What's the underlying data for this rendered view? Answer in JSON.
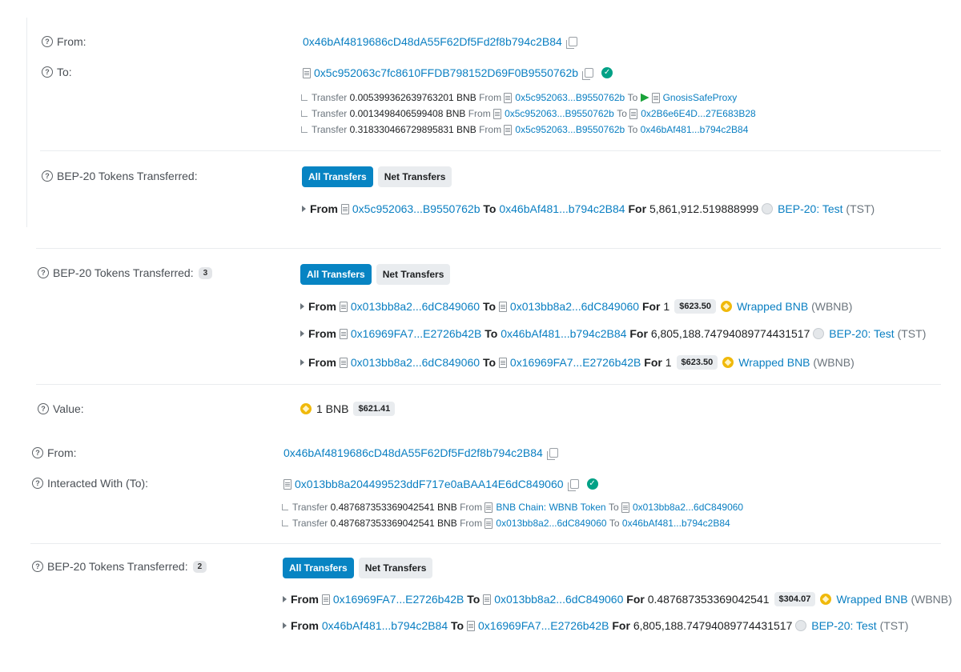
{
  "sec1": {
    "from_label": "From:",
    "from_addr": "0x46bAf4819686cD48dA55F62Df5Fd2f8b794c2B84",
    "to_label": "To:",
    "to_addr": "0x5c952063c7fc8610FFDB798152D69F0B9550762b",
    "internal": [
      {
        "kw": "Transfer",
        "amount": "0.005399362639763201 BNB",
        "from_kw": "From",
        "from": "0x5c952063...B9550762b",
        "to_kw": "To",
        "to": "GnosisSafeProxy"
      },
      {
        "kw": "Transfer",
        "amount": "0.0013498406599408 BNB",
        "from_kw": "From",
        "from": "0x5c952063...B9550762b",
        "to_kw": "To",
        "to": "0x2B6e6E4D...27E683B28"
      },
      {
        "kw": "Transfer",
        "amount": "0.318330466729895831 BNB",
        "from_kw": "From",
        "from": "0x5c952063...B9550762b",
        "to_kw": "To",
        "to": "0x46bAf481...b794c2B84"
      }
    ],
    "tokens_label": "BEP-20 Tokens Transferred:",
    "btn_all": "All Transfers",
    "btn_net": "Net Transfers",
    "transfers": [
      {
        "from_kw": "From",
        "from": "0x5c952063...B9550762b",
        "to_kw": "To",
        "to": "0x46bAf481...b794c2B84",
        "for_kw": "For",
        "amount": "5,861,912.519888999",
        "token": "BEP-20: Test",
        "symbol": "(TST)"
      }
    ]
  },
  "sec2": {
    "tokens_label": "BEP-20 Tokens Transferred:",
    "count": "3",
    "btn_all": "All Transfers",
    "btn_net": "Net Transfers",
    "transfers": [
      {
        "from_kw": "From",
        "from": "0x013bb8a2...6dC849060",
        "to_kw": "To",
        "to": "0x013bb8a2...6dC849060",
        "for_kw": "For",
        "amount": "1",
        "price": "$623.50",
        "token": "Wrapped BNB",
        "symbol": "(WBNB)"
      },
      {
        "from_kw": "From",
        "from": "0x16969FA7...E2726b42B",
        "to_kw": "To",
        "to": "0x46bAf481...b794c2B84",
        "for_kw": "For",
        "amount": "6,805,188.74794089774431517",
        "token": "BEP-20: Test",
        "symbol": "(TST)"
      },
      {
        "from_kw": "From",
        "from": "0x013bb8a2...6dC849060",
        "to_kw": "To",
        "to": "0x16969FA7...E2726b42B",
        "for_kw": "For",
        "amount": "1",
        "price": "$623.50",
        "token": "Wrapped BNB",
        "symbol": "(WBNB)"
      }
    ],
    "value_label": "Value:",
    "value": "1 BNB",
    "value_price": "$621.41"
  },
  "sec3": {
    "from_label": "From:",
    "from_addr": "0x46bAf4819686cD48dA55F62Df5Fd2f8b794c2B84",
    "to_label": "Interacted With (To):",
    "to_addr": "0x013bb8a204499523ddF717e0aBAA14E6dC849060",
    "internal": [
      {
        "kw": "Transfer",
        "amount": "0.487687353369042541 BNB",
        "from_kw": "From",
        "from": "BNB Chain: WBNB Token",
        "to_kw": "To",
        "to": "0x013bb8a2...6dC849060"
      },
      {
        "kw": "Transfer",
        "amount": "0.487687353369042541 BNB",
        "from_kw": "From",
        "from": "0x013bb8a2...6dC849060",
        "to_kw": "To",
        "to": "0x46bAf481...b794c2B84"
      }
    ],
    "tokens_label": "BEP-20 Tokens Transferred:",
    "count": "2",
    "btn_all": "All Transfers",
    "btn_net": "Net Transfers",
    "transfers": [
      {
        "from_kw": "From",
        "from": "0x16969FA7...E2726b42B",
        "to_kw": "To",
        "to": "0x013bb8a2...6dC849060",
        "for_kw": "For",
        "amount": "0.487687353369042541",
        "price": "$304.07",
        "token": "Wrapped BNB",
        "symbol": "(WBNB)"
      },
      {
        "from_kw": "From",
        "from": "0x46bAf481...b794c2B84",
        "to_kw": "To",
        "to": "0x16969FA7...E2726b42B",
        "for_kw": "For",
        "amount": "6,805,188.74794089774431517",
        "token": "BEP-20: Test",
        "symbol": "(TST)"
      }
    ]
  }
}
